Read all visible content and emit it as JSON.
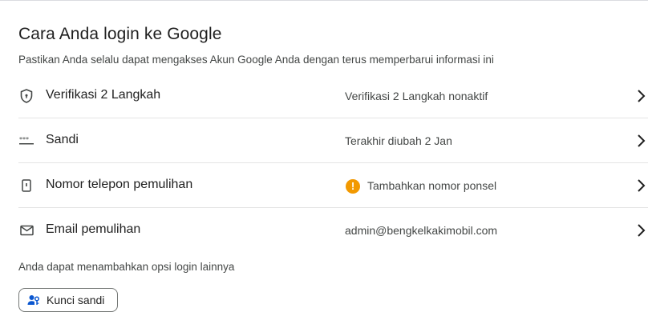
{
  "section": {
    "title": "Cara Anda login ke Google",
    "subtitle": "Pastikan Anda selalu dapat mengakses Akun Google Anda dengan terus memperbarui informasi ini"
  },
  "rows": [
    {
      "icon": "shield-icon",
      "label": "Verifikasi 2 Langkah",
      "value": "Verifikasi 2 Langkah nonaktif",
      "warning": false
    },
    {
      "icon": "password-dots-icon",
      "label": "Sandi",
      "value": "Terakhir diubah 2 Jan",
      "warning": false
    },
    {
      "icon": "phone-icon",
      "label": "Nomor telepon pemulihan",
      "value": "Tambahkan nomor ponsel",
      "warning": true,
      "warning_glyph": "!"
    },
    {
      "icon": "mail-icon",
      "label": "Email pemulihan",
      "value": "admin@bengkelkakimobil.com",
      "warning": false
    }
  ],
  "footer": {
    "note": "Anda dapat menambahkan opsi login lainnya",
    "passkey_button": "Kunci sandi"
  },
  "colors": {
    "warning": "#f29900",
    "accent": "#0b57d0",
    "text": "#1f1f1f",
    "secondary_text": "#444746"
  }
}
